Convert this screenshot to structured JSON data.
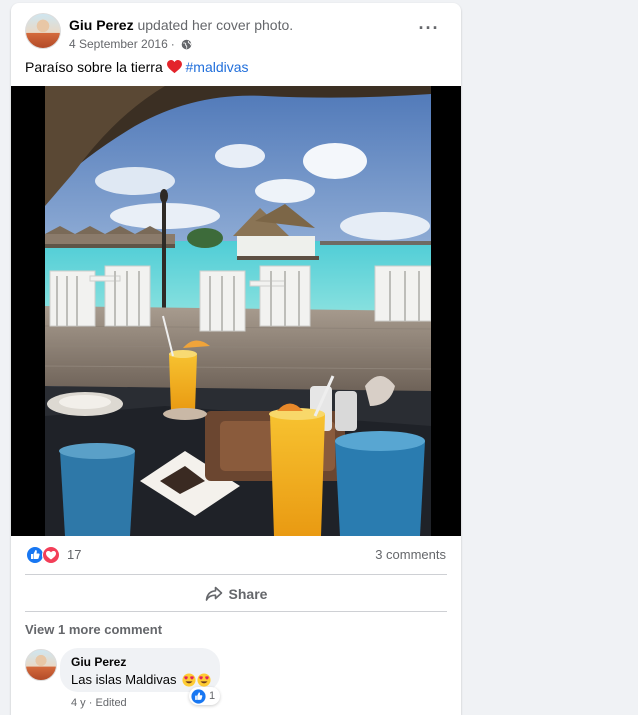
{
  "post": {
    "author": "Giu Perez",
    "action": "updated her cover photo.",
    "date": "4 September 2016",
    "separator": "·",
    "audience_icon": "globe-icon",
    "more_label": "···",
    "caption_text": "Paraíso sobre la tierra",
    "caption_emoji": "red-heart",
    "hashtag": "#maldivas"
  },
  "stats": {
    "reaction_types": [
      "like",
      "love"
    ],
    "reaction_count": "17",
    "comments_label": "3 comments"
  },
  "actions": {
    "share_label": "Share"
  },
  "comments": {
    "view_more_label": "View 1 more comment",
    "items": [
      {
        "author": "Giu Perez",
        "text": "Las islas Maldivas",
        "emojis": [
          "heart-eyes",
          "heart-eyes"
        ],
        "reaction_count": "1",
        "age": "4 y",
        "separator": "·",
        "edited_label": "Edited"
      }
    ]
  },
  "colors": {
    "link": "#216fdb",
    "muted": "#65676b",
    "like_blue": "#1877f2",
    "love_red": "#f33e58",
    "background": "#f0f2f5"
  }
}
